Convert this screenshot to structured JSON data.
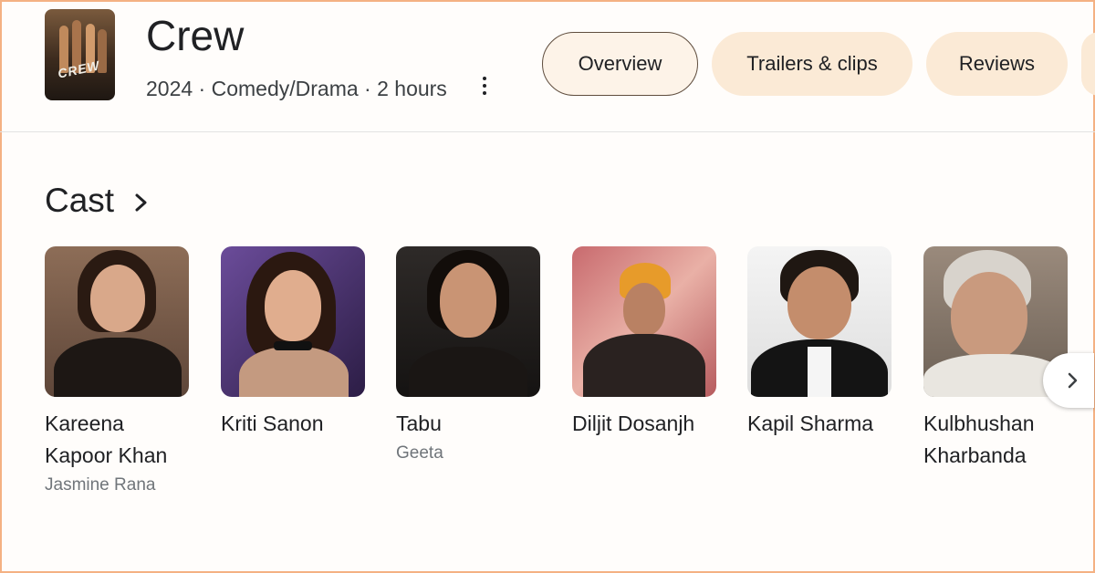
{
  "movie": {
    "title": "Crew",
    "meta": "2024 · Comedy/Drama · 2 hours",
    "poster_text": "CREW"
  },
  "tabs": [
    {
      "label": "Overview",
      "active": true
    },
    {
      "label": "Trailers & clips",
      "active": false
    },
    {
      "label": "Reviews",
      "active": false
    }
  ],
  "cast": {
    "title": "Cast",
    "members": [
      {
        "name": "Kareena Kapoor Khan",
        "role": "Jasmine Rana"
      },
      {
        "name": "Kriti Sanon",
        "role": ""
      },
      {
        "name": "Tabu",
        "role": "Geeta"
      },
      {
        "name": "Diljit Dosanjh",
        "role": ""
      },
      {
        "name": "Kapil Sharma",
        "role": ""
      },
      {
        "name": "Kulbhushan Kharbanda",
        "role": ""
      }
    ]
  },
  "icons": {
    "more": "more-vert-icon",
    "section_arrow": "chevron-right-icon",
    "next": "chevron-right-icon"
  },
  "colors": {
    "tab_fill": "#fbead6",
    "tab_active_border": "#5f4d3e",
    "frame_border": "#f4b183"
  }
}
